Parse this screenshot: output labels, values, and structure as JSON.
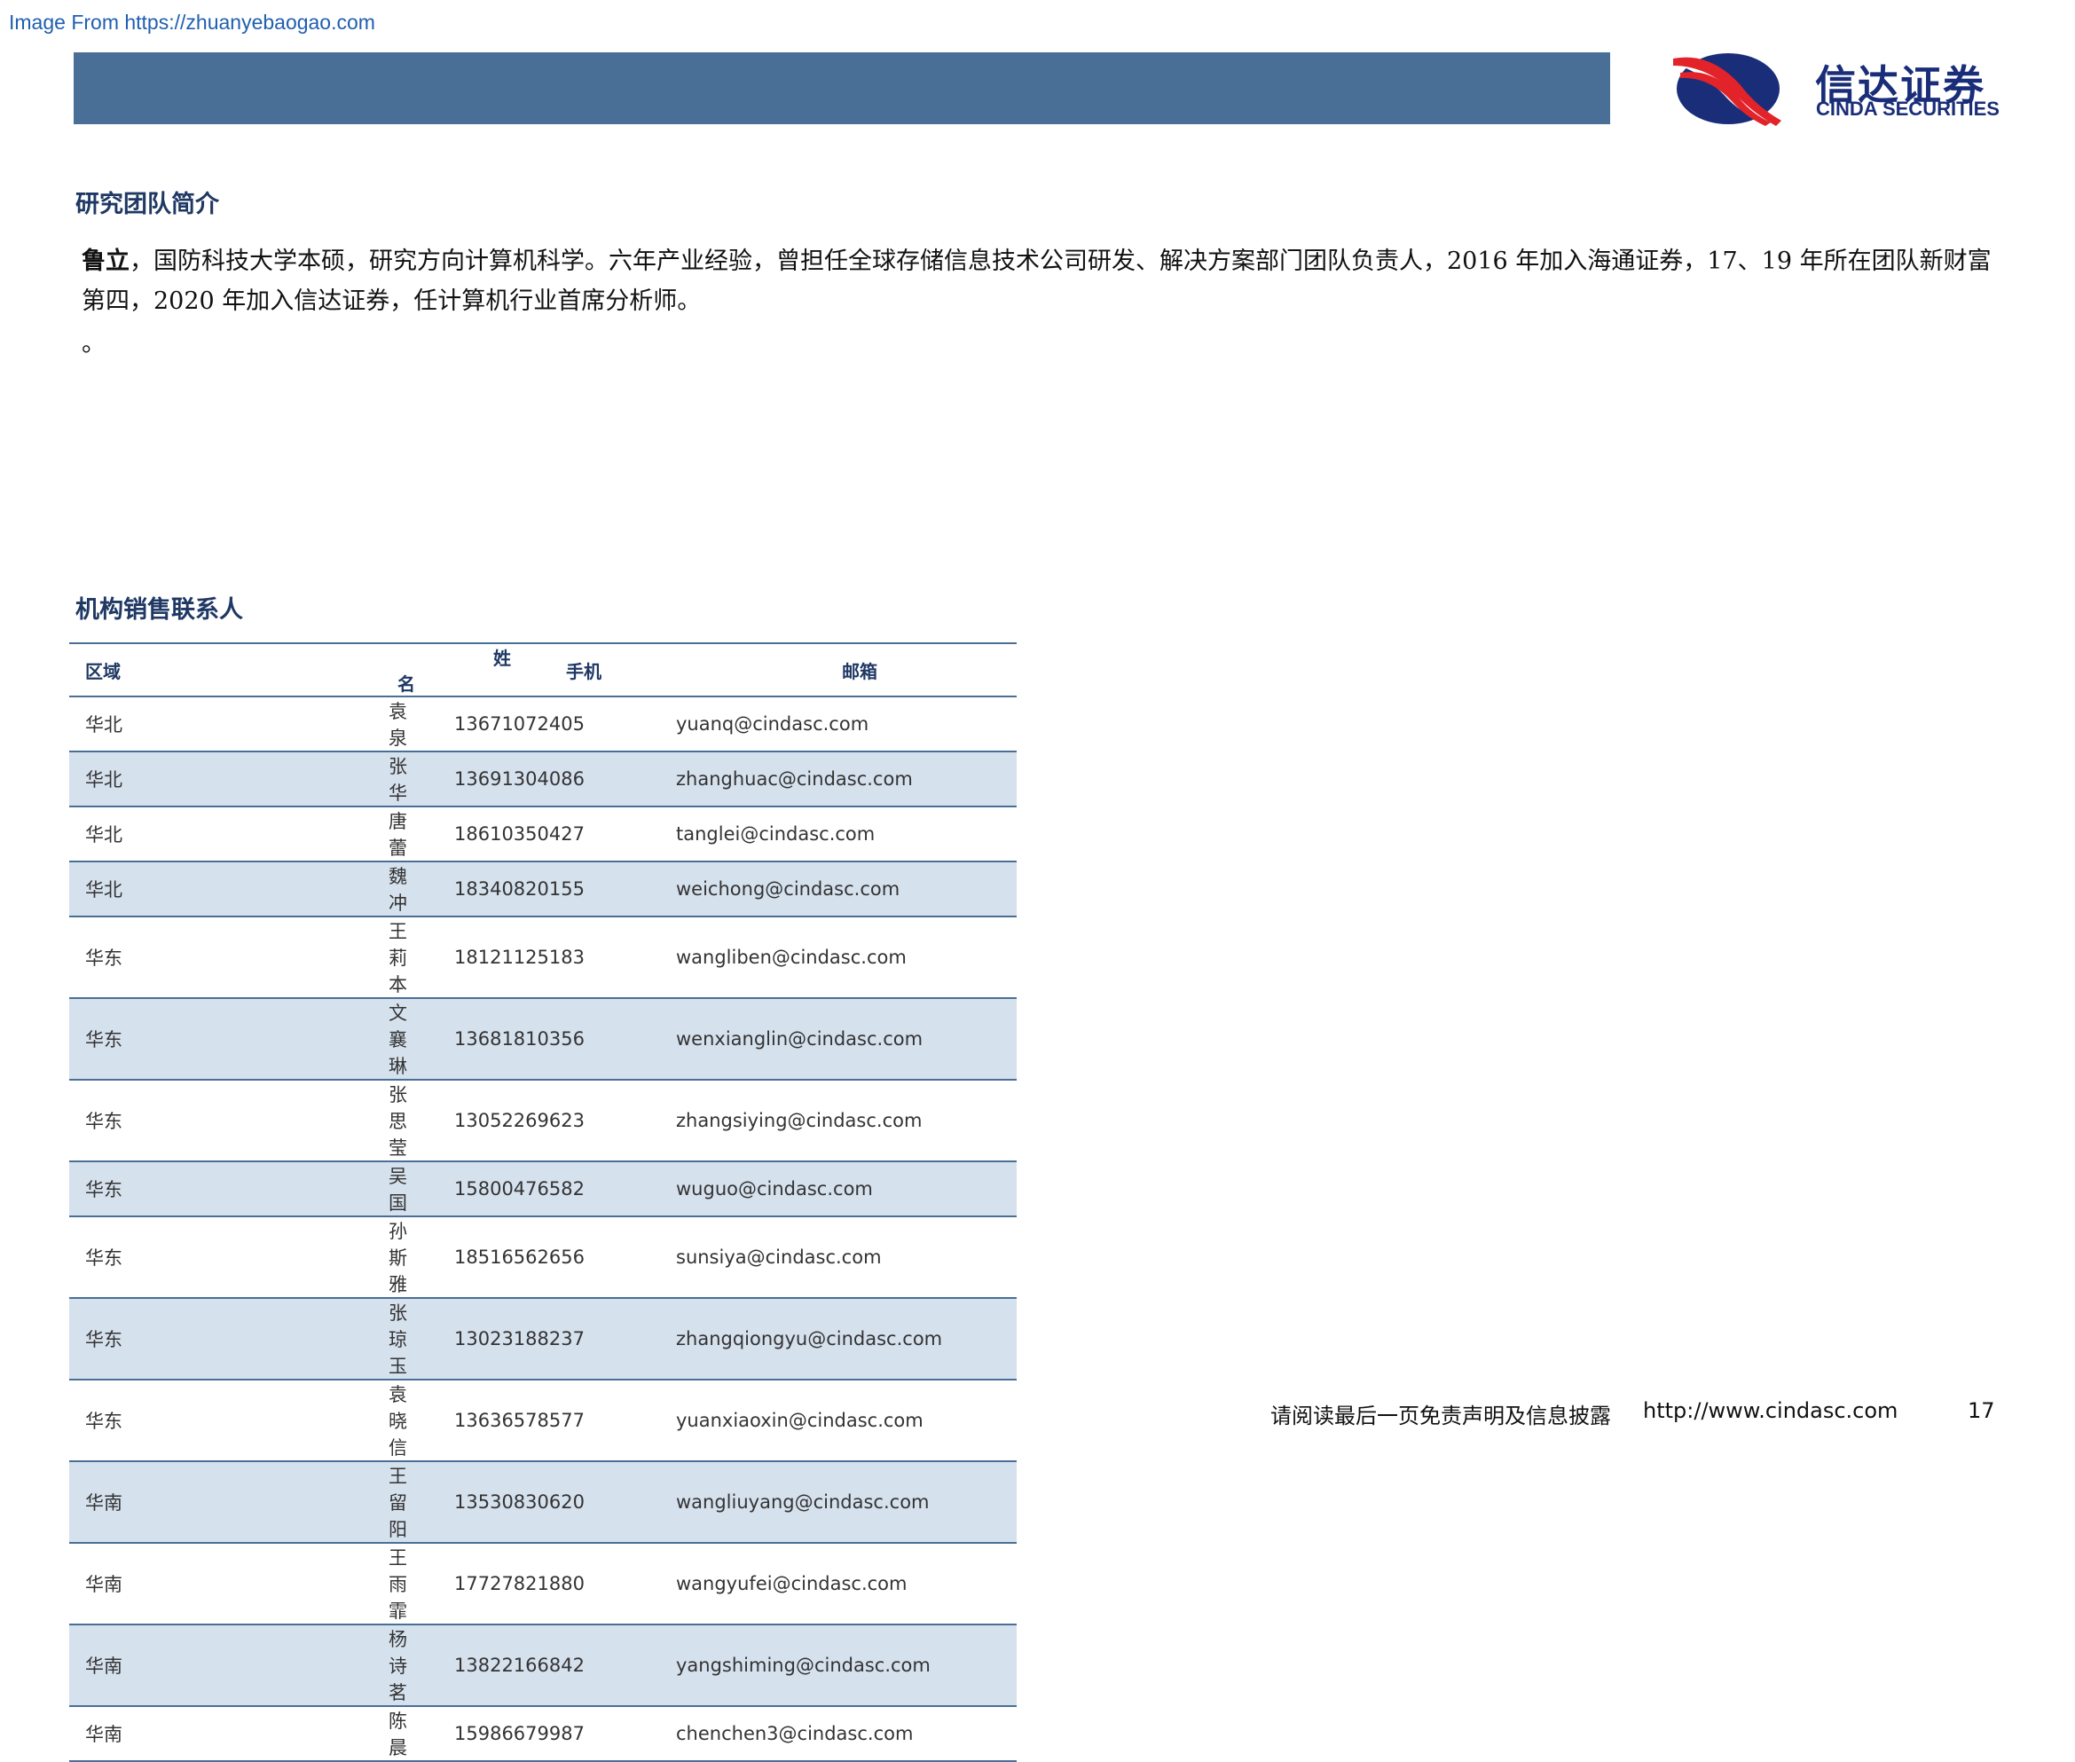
{
  "watermark": "Image From https://zhuanyebaogao.com",
  "logo": {
    "cn": "信达证券",
    "en": "CINDA SECURITIES"
  },
  "team_section": {
    "title": "研究团队简介",
    "name": "鲁立",
    "bio": "，国防科技大学本硕，研究方向计算机科学。六年产业经验，曾担任全球存储信息技术公司研发、解决方案部门团队负责人，2016 年加入海通证券，17、19 年所在团队新财富第四，2020 年加入信达证券，任计算机行业首席分析师。",
    "extra": "。"
  },
  "sales_section": {
    "title": "机构销售联系人",
    "headers": [
      "区域",
      "姓名",
      "手机",
      "邮箱"
    ],
    "rows": [
      [
        "华北",
        "袁　泉",
        "13671072405",
        "yuanq@cindasc.com"
      ],
      [
        "华北",
        "张　华",
        "13691304086",
        "zhanghuac@cindasc.com"
      ],
      [
        "华北",
        "唐　蕾",
        "18610350427",
        "tanglei@cindasc.com"
      ],
      [
        "华北",
        "魏　冲",
        "18340820155",
        "weichong@cindasc.com"
      ],
      [
        "华东",
        "王莉本",
        "18121125183",
        "wangliben@cindasc.com"
      ],
      [
        "华东",
        "文襄琳",
        "13681810356",
        "wenxianglin@cindasc.com"
      ],
      [
        "华东",
        "张思莹",
        "13052269623",
        "zhangsiying@cindasc.com"
      ],
      [
        "华东",
        "吴　国",
        "15800476582",
        "wuguo@cindasc.com"
      ],
      [
        "华东",
        "孙斯雅",
        "18516562656",
        "sunsiya@cindasc.com"
      ],
      [
        "华东",
        "张琼玉",
        "13023188237",
        "zhangqiongyu@cindasc.com"
      ],
      [
        "华东",
        "袁晓信",
        "13636578577",
        "yuanxiaoxin@cindasc.com"
      ],
      [
        "华南",
        "王留阳",
        "13530830620",
        "wangliuyang@cindasc.com"
      ],
      [
        "华南",
        "王雨霏",
        "17727821880",
        "wangyufei@cindasc.com"
      ],
      [
        "华南",
        "杨诗茗",
        "13822166842",
        "yangshiming@cindasc.com"
      ],
      [
        "华南",
        "陈　晨",
        "15986679987",
        "chenchen3@cindasc.com"
      ]
    ]
  },
  "footer": {
    "note": "请阅读最后一页免责声明及信息披露",
    "url": "http://www.cindasc.com",
    "page": "17"
  },
  "colors": {
    "band": "#4a6f97",
    "row_alt": "#d6e1ee",
    "title": "#1f3864",
    "logo_blue": "#1a2d78",
    "logo_red": "#e2232a"
  }
}
